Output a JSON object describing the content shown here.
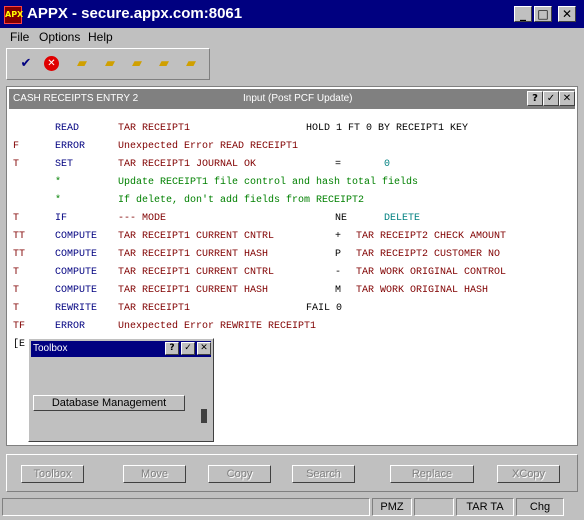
{
  "window": {
    "icon_text": "APX",
    "title": "APPX - secure.appx.com:8061",
    "min_glyph": "_",
    "max_glyph": "□",
    "close_glyph": "✕"
  },
  "menu": {
    "file": "File",
    "options": "Options",
    "help": "Help"
  },
  "toolbar_icons": [
    "check-icon",
    "cancel-icon",
    "new-folder-icon",
    "folder-up-icon",
    "folder-search-icon",
    "folder-edit-icon",
    "folder-delete-icon"
  ],
  "inner_window": {
    "title": "CASH RECEIPTS ENTRY 2",
    "mode": "Input  (Post PCF Update)",
    "help_glyph": "?",
    "ok_glyph": "✓",
    "close_glyph": "✕"
  },
  "code": [
    {
      "flag": "",
      "verb": "READ",
      "arg": "TAR RECEIPT1",
      "op": "HOLD 1 FT 0 BY RECEIPT1 KEY",
      "tail": ""
    },
    {
      "flag": "F",
      "verb": "ERROR",
      "arg": "Unexpected Error READ RECEIPT1",
      "op": "",
      "tail": ""
    },
    {
      "flag": "T",
      "verb": "SET",
      "arg": "TAR RECEIPT1 JOURNAL OK",
      "op": "=",
      "tail": "0"
    },
    {
      "flag": "",
      "verb": "*",
      "arg": "Update RECEIPT1 file control and hash total fields",
      "op": "",
      "tail": ""
    },
    {
      "flag": "",
      "verb": "*",
      "arg": "If delete, don't add fields from RECEIPT2",
      "op": "",
      "tail": ""
    },
    {
      "flag": "T",
      "verb": "IF",
      "arg": "--- MODE",
      "op": "NE",
      "tail": "DELETE"
    },
    {
      "flag": "TT",
      "verb": "COMPUTE",
      "arg": "TAR RECEIPT1 CURRENT CNTRL",
      "op": "+",
      "tail": "TAR RECEIPT2 CHECK AMOUNT"
    },
    {
      "flag": "TT",
      "verb": "COMPUTE",
      "arg": "TAR RECEIPT1 CURRENT HASH",
      "op": "P",
      "tail": "TAR RECEIPT2 CUSTOMER NO"
    },
    {
      "flag": "T",
      "verb": "COMPUTE",
      "arg": "TAR RECEIPT1 CURRENT CNTRL",
      "op": "-",
      "tail": "TAR WORK ORIGINAL CONTROL"
    },
    {
      "flag": "T",
      "verb": "COMPUTE",
      "arg": "TAR RECEIPT1 CURRENT HASH",
      "op": "M",
      "tail": "TAR WORK ORIGINAL HASH"
    },
    {
      "flag": "T",
      "verb": "REWRITE",
      "arg": "TAR RECEIPT1",
      "op": "FAIL 0",
      "tail": ""
    },
    {
      "flag": "TF",
      "verb": "ERROR",
      "arg": "Unexpected Error REWRITE RECEIPT1",
      "op": "",
      "tail": ""
    },
    {
      "flag": "[E",
      "verb": "",
      "arg": "",
      "op": "",
      "tail": ""
    }
  ],
  "toolbox": {
    "title": "Toolbox",
    "help_glyph": "?",
    "ok_glyph": "✓",
    "close_glyph": "✕",
    "button": "Database Management"
  },
  "buttons": {
    "toolbox": "Toolbox",
    "move": "Move",
    "copy": "Copy",
    "search": "Search",
    "replace": "Replace",
    "xcopy": "XCopy"
  },
  "status": {
    "pmz": "PMZ",
    "tar_ta": "TAR TA",
    "chg": "Chg"
  }
}
